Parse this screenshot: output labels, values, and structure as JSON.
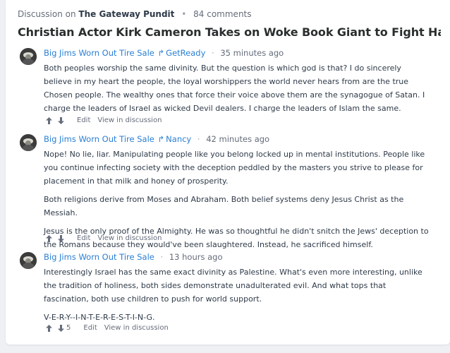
{
  "header": {
    "prefix": "Discussion on",
    "site": "The Gateway Pundit",
    "comment_count": "84 comments"
  },
  "title": "Christian Actor Kirk Cameron Takes on Woke Book Giant to Fight Harmful,...",
  "comments": [
    {
      "author": "Big Jims Worn Out Tire Sale",
      "reply_to": "GetReady",
      "time": "35 minutes ago",
      "paragraphs": [
        "Both peoples worship the same divinity. But the question is which god is that? I do sincerely believe in my heart the people, the loyal worshippers the world never hears from are the true Chosen people. The wealthy ones that force their voice above them are the synagogue of Satan. I charge the leaders of Israel as wicked Devil dealers. I charge the leaders of Islam the same."
      ],
      "downvotes": "",
      "edit": "Edit",
      "view": "View in discussion"
    },
    {
      "author": "Big Jims Worn Out Tire Sale",
      "reply_to": "Nancy",
      "time": "42 minutes ago",
      "paragraphs": [
        "Nope! No lie, liar. Manipulating people like you belong locked up in mental institutions. People like you continue infecting society with the deception peddled by the masters you strive to please for placement in that milk and honey of prosperity.",
        "Both religions derive from Moses and Abraham. Both belief systems deny Jesus Christ as the Messiah.",
        "Jesus is the only proof of the Almighty. He was so thoughtful he didn't snitch the Jews' deception to the Romans because they would've been slaughtered. Instead, he sacrificed himself."
      ],
      "downvotes": "",
      "edit": "Edit",
      "view": "View in discussion"
    },
    {
      "author": "Big Jims Worn Out Tire Sale",
      "reply_to": "",
      "time": "13 hours ago",
      "paragraphs": [
        "Interestingly Israel has the same exact divinity as Palestine. What's even more interesting, unlike the tradition of holiness, both sides demonstrate unadulterated evil. And what tops that fascination, both use children to push for world support.",
        "V-E-R-Y--I-N-T-E-R-E-S-T-I-N-G."
      ],
      "downvotes": "5",
      "edit": "Edit",
      "view": "View in discussion"
    }
  ],
  "colors": {
    "link": "#2a7fd4",
    "text": "#2e3a48",
    "muted": "#656c7a"
  }
}
